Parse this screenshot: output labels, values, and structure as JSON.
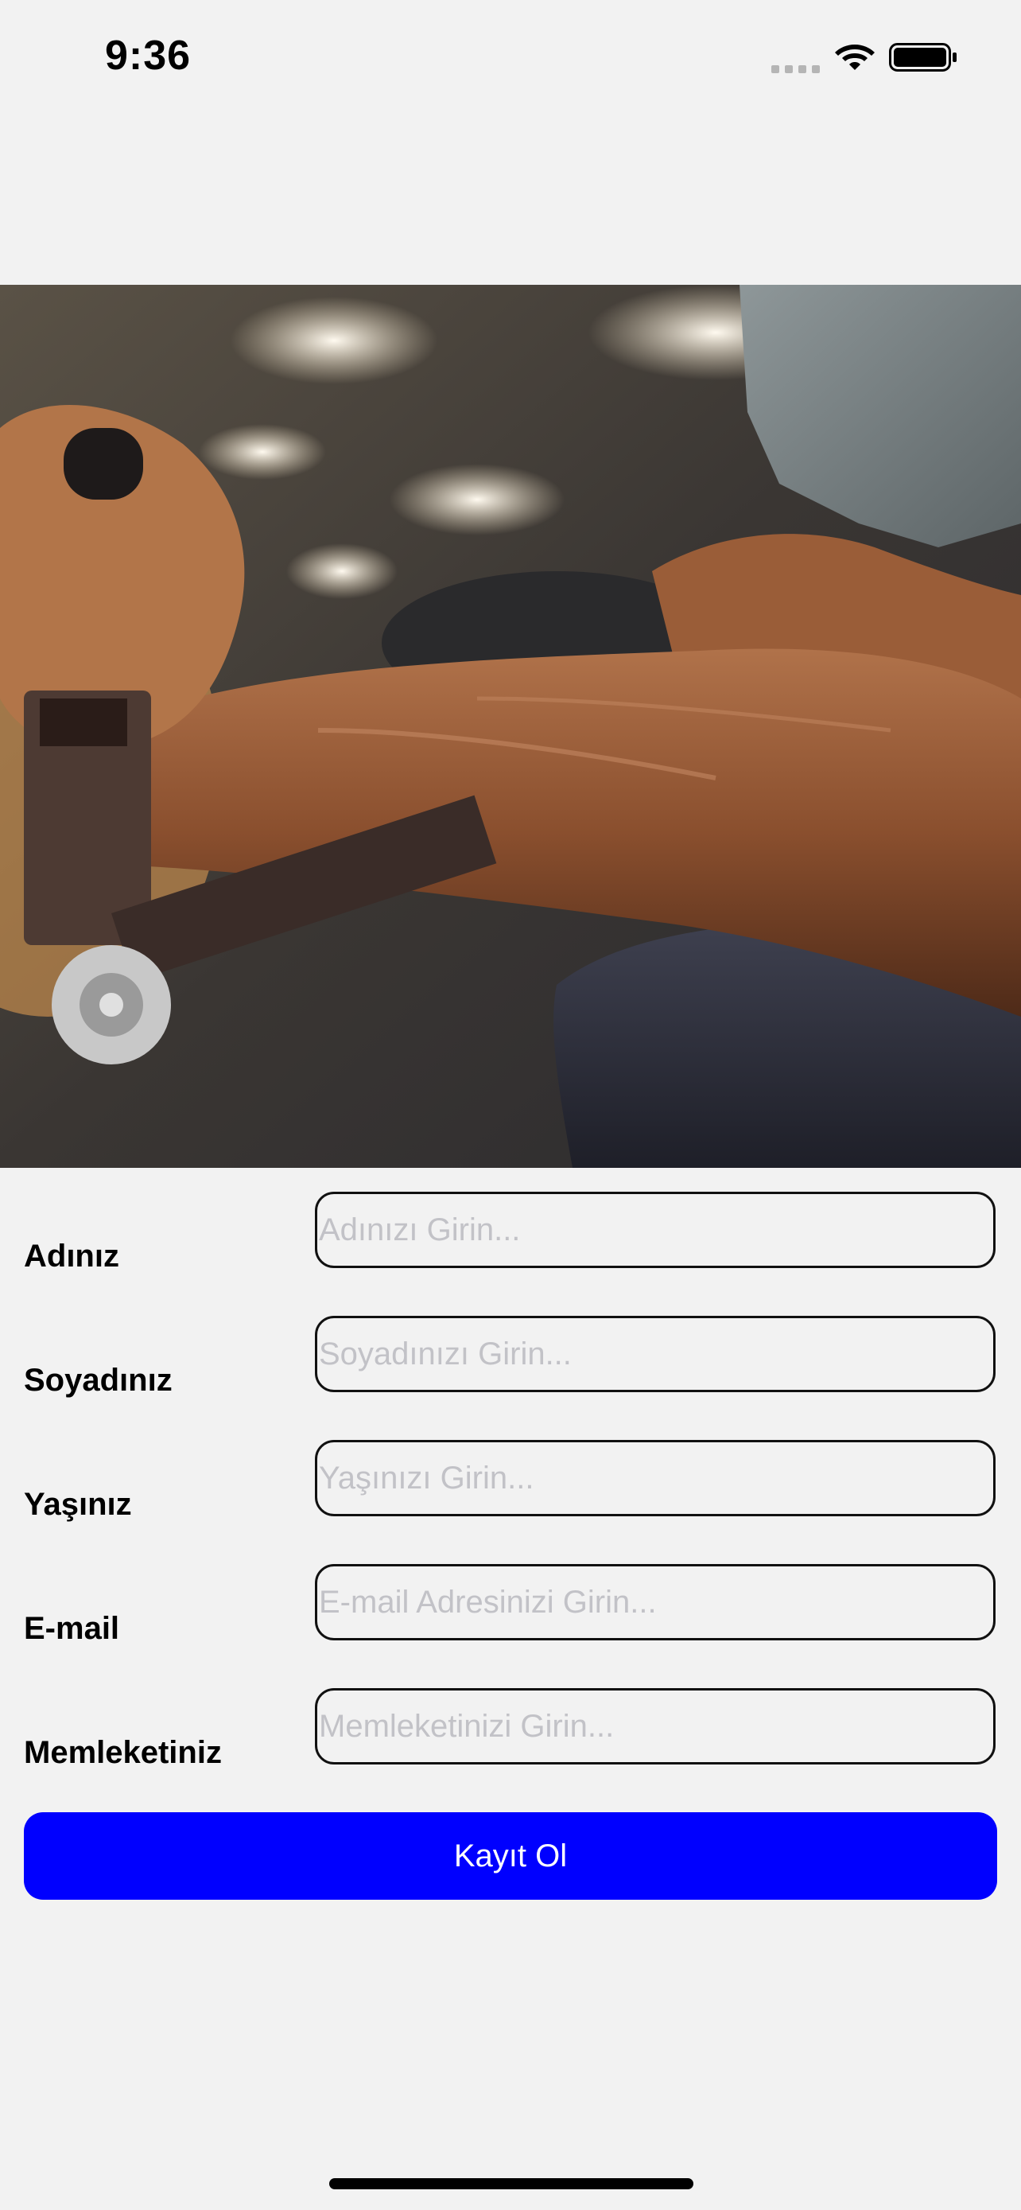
{
  "status_bar": {
    "time": "9:36"
  },
  "hero_image": {
    "subject": "gym-arm-workout-photo"
  },
  "form": {
    "fields": [
      {
        "label": "Adınız",
        "placeholder": "Adınızı Girin...",
        "value": ""
      },
      {
        "label": "Soyadınız",
        "placeholder": "Soyadınızı Girin...",
        "value": ""
      },
      {
        "label": "Yaşınız",
        "placeholder": "Yaşınızı Girin...",
        "value": ""
      },
      {
        "label": "E-mail",
        "placeholder": "E-mail Adresinizi Girin...",
        "value": ""
      },
      {
        "label": "Memleketiniz",
        "placeholder": "Memleketinizi Girin...",
        "value": ""
      }
    ],
    "submit_label": "Kayıt Ol"
  },
  "colors": {
    "background": "#f2f2f2",
    "button_primary": "#0000ff",
    "button_text": "#ffffff",
    "placeholder": "#c2c2c7"
  }
}
